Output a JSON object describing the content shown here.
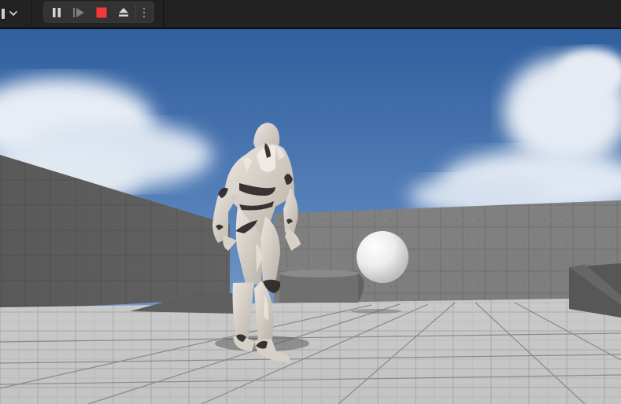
{
  "toolbar": {
    "mode_icon": "viewport-mode-icon",
    "dropdown_icon": "chevron-down-icon",
    "buttons": [
      {
        "id": "pause",
        "icon": "pause-icon"
      },
      {
        "id": "step",
        "icon": "step-frame-icon"
      },
      {
        "id": "stop",
        "icon": "stop-icon",
        "color": "#f23a3a"
      },
      {
        "id": "eject",
        "icon": "eject-icon"
      },
      {
        "id": "more",
        "icon": "more-options-icon"
      }
    ]
  },
  "viewport": {
    "scene_elements": [
      "sky",
      "clouds",
      "wall-left",
      "wall-back",
      "floor-grid",
      "ramp-left",
      "ramp-right",
      "cylinder-block",
      "sphere",
      "mannequin-character"
    ],
    "colors": {
      "sky_top": "#2f5f9e",
      "sky_bottom": "#7ea6d2",
      "wall": "#646464",
      "floor": "#b8b8b8",
      "character": "#d7d0c7",
      "sphere": "#f4f4f4"
    }
  }
}
